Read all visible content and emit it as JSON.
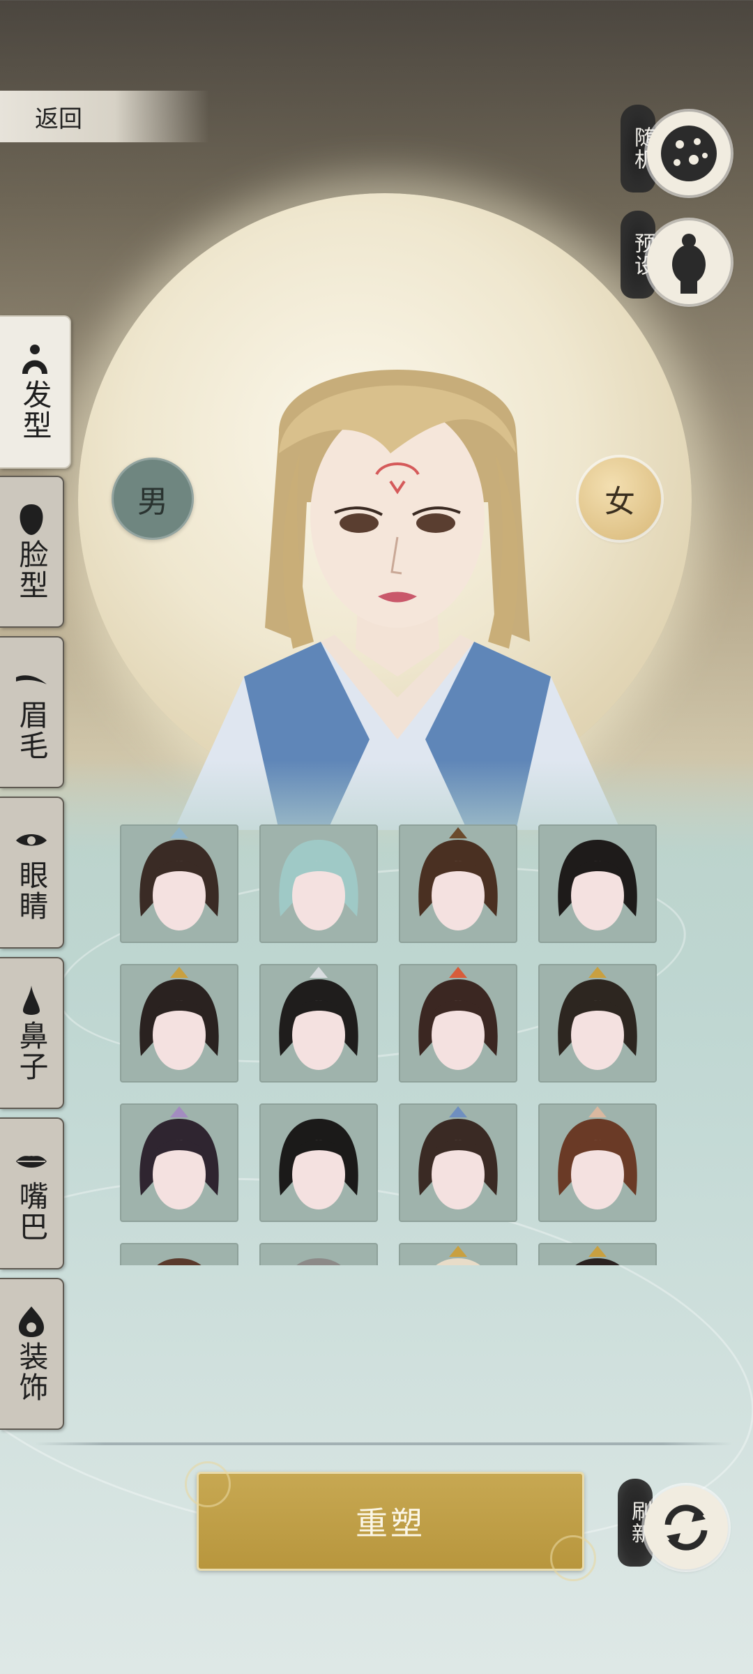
{
  "header": {
    "back_label": "返回"
  },
  "right_actions": [
    {
      "id": "random",
      "label": "随机",
      "icon": "dice-moon-icon"
    },
    {
      "id": "preset",
      "label": "预设",
      "icon": "head-silhouette-icon"
    }
  ],
  "gender": {
    "male_label": "男",
    "female_label": "女",
    "selected": "女"
  },
  "side_tabs": [
    {
      "label": "发型",
      "icon": "hair-bun-icon",
      "active": true
    },
    {
      "label": "脸型",
      "icon": "face-silhouette-icon",
      "active": false
    },
    {
      "label": "眉毛",
      "icon": "eyebrow-icon",
      "active": false
    },
    {
      "label": "眼睛",
      "icon": "eye-icon",
      "active": false
    },
    {
      "label": "鼻子",
      "icon": "nose-icon",
      "active": false
    },
    {
      "label": "嘴巴",
      "icon": "lips-icon",
      "active": false
    },
    {
      "label": "装饰",
      "icon": "ornament-icon",
      "active": false
    }
  ],
  "hairstyles": [
    {
      "hair": "#3a2b25",
      "accent": "#8fb4c8"
    },
    {
      "hair": "#9fc9c6",
      "accent": ""
    },
    {
      "hair": "#4a3022",
      "accent": "#6b4a2c"
    },
    {
      "hair": "#1e1b1a",
      "accent": ""
    },
    {
      "hair": "#2a2220",
      "accent": "#c9a040"
    },
    {
      "hair": "#1f1d1c",
      "accent": "#d9dde0"
    },
    {
      "hair": "#3b2722",
      "accent": "#d85c3a"
    },
    {
      "hair": "#2d2620",
      "accent": "#c9a040"
    },
    {
      "hair": "#2f2530",
      "accent": "#a38cc0"
    },
    {
      "hair": "#1b1a19",
      "accent": ""
    },
    {
      "hair": "#3a2a24",
      "accent": "#6f8fc0"
    },
    {
      "hair": "#6a3a26",
      "accent": "#d9b8a0"
    },
    {
      "hair": "#5a3a2c",
      "accent": ""
    },
    {
      "hair": "#8c8a88",
      "accent": ""
    },
    {
      "hair": "#e8dcc8",
      "accent": "#c9a040"
    },
    {
      "hair": "#2a2220",
      "accent": "#c9a040"
    }
  ],
  "bottom": {
    "reshape_label": "重塑",
    "refresh_label": "刷新"
  },
  "colors": {
    "gold": "#b8963d",
    "tab_bg": "#ccc7bd",
    "active_tab_bg": "#efece4"
  }
}
